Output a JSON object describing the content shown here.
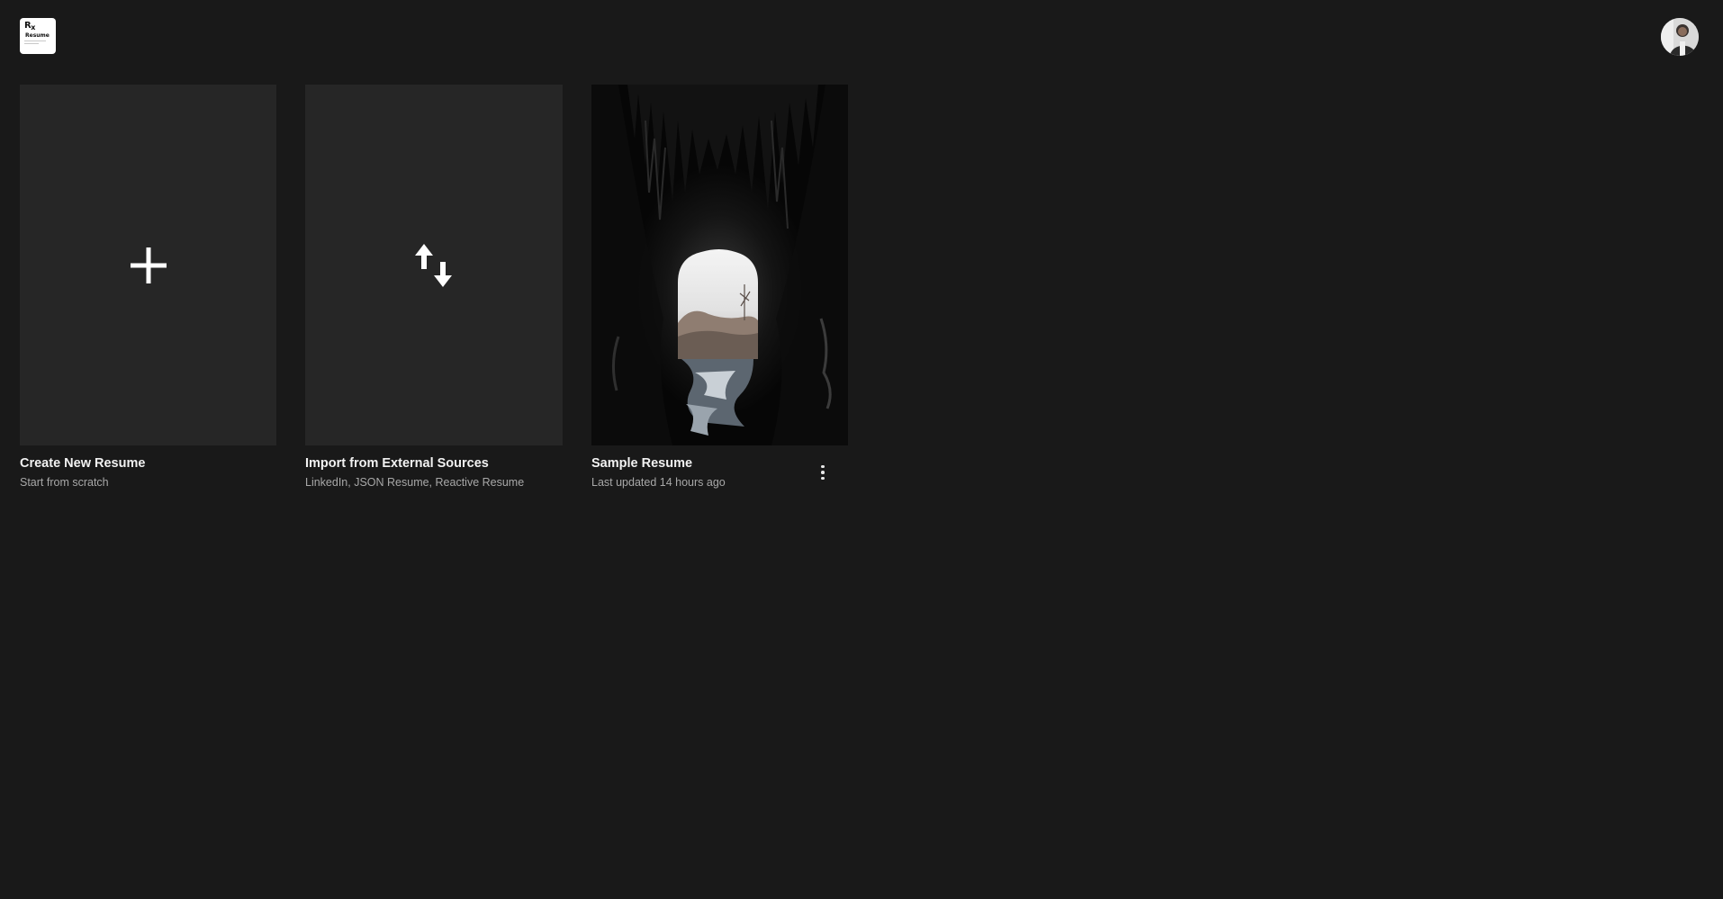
{
  "header": {
    "logo": {
      "monogram": "Rx",
      "wordmark": "Resume"
    },
    "avatar_icon": "user-avatar"
  },
  "cards": [
    {
      "title": "Create New Resume",
      "subtitle": "Start from scratch",
      "icon": "plus-icon"
    },
    {
      "title": "Import from External Sources",
      "subtitle": "LinkedIn, JSON Resume, Reactive Resume",
      "icon": "arrows-up-down-icon"
    },
    {
      "title": "Sample Resume",
      "subtitle": "Last updated 14 hours ago",
      "icon": "more-vertical-icon"
    }
  ],
  "colors": {
    "background": "#191919",
    "tile": "#262626",
    "text_primary": "#f2f2f2",
    "text_secondary": "#a8a8a8"
  }
}
